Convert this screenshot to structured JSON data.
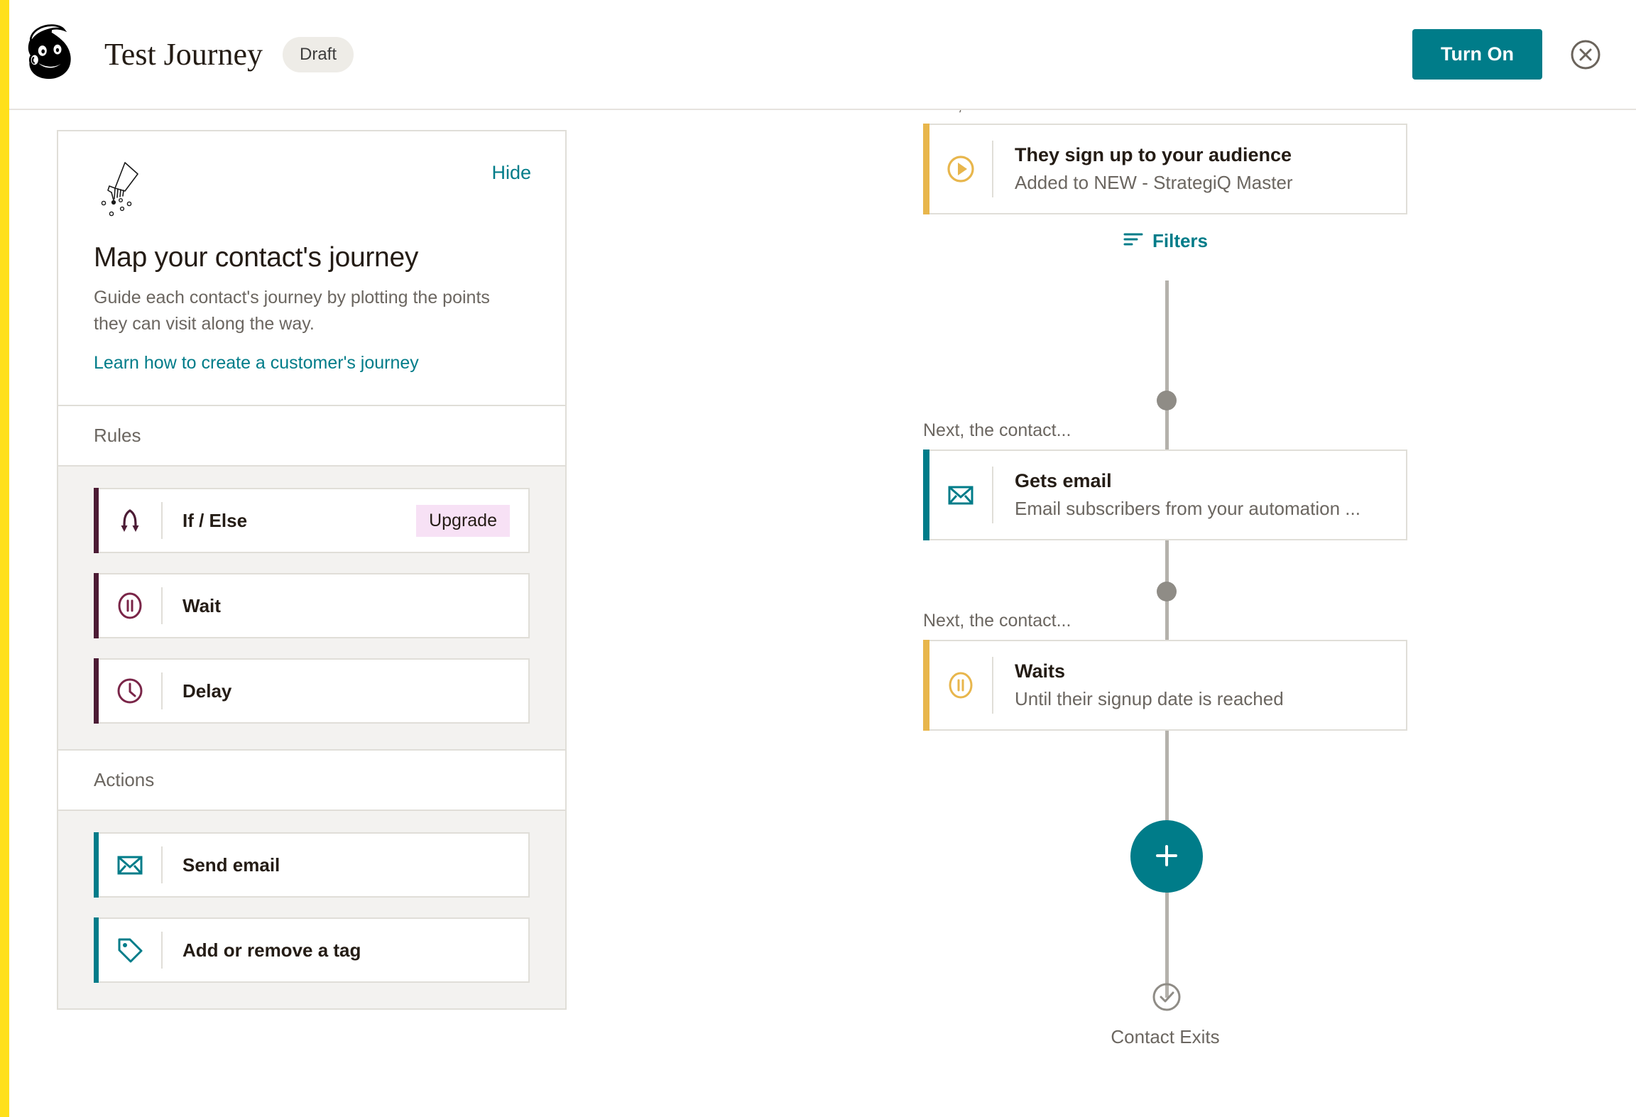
{
  "brand": {
    "accent_teal": "#007c89",
    "accent_yellow": "#ffe01b",
    "accent_gold": "#e8b64c",
    "accent_maroon": "#4c1c35",
    "upgrade_pink": "#f7e1f5"
  },
  "header": {
    "logo_name": "mailchimp-freddie-logo",
    "title": "Test Journey",
    "status_badge": "Draft",
    "turn_on_label": "Turn On",
    "close_icon": "close-circle-icon"
  },
  "left_panel": {
    "hide_label": "Hide",
    "illustration_name": "hand-sprinkling-seeds-illustration",
    "heading": "Map your contact's journey",
    "description": "Guide each contact's journey by plotting the points they can visit along the way.",
    "learn_link": "Learn how to create a customer's journey",
    "sections": [
      {
        "title": "Rules",
        "items": [
          {
            "label": "If / Else",
            "icon": "branch-arrows-icon",
            "badge": "Upgrade",
            "accent": "rule"
          },
          {
            "label": "Wait",
            "icon": "pause-circle-icon",
            "badge": null,
            "accent": "rule"
          },
          {
            "label": "Delay",
            "icon": "clock-icon",
            "badge": null,
            "accent": "rule"
          }
        ]
      },
      {
        "title": "Actions",
        "items": [
          {
            "label": "Send email",
            "icon": "envelope-icon",
            "badge": null,
            "accent": "action"
          },
          {
            "label": "Add or remove a tag",
            "icon": "tag-icon",
            "badge": null,
            "accent": "action"
          }
        ]
      }
    ]
  },
  "journey": {
    "trigger": {
      "caption": "First, a contact is added when...",
      "title": "They sign up to your audience",
      "subtitle": "Added to NEW - StrategiQ Master",
      "icon": "play-circle-icon"
    },
    "filters_label": "Filters",
    "filters_icon": "filter-lines-icon",
    "steps": [
      {
        "caption": "Next, the contact...",
        "title": "Gets email",
        "subtitle": "Email subscribers from your automation ...",
        "icon": "envelope-icon",
        "accent": "email"
      },
      {
        "caption": "Next, the contact...",
        "title": "Waits",
        "subtitle": "Until their signup date is reached",
        "icon": "pause-circle-icon",
        "accent": "wait"
      }
    ],
    "add_step_icon": "plus-icon",
    "exit_icon": "check-circle-icon",
    "exit_label": "Contact Exits"
  }
}
